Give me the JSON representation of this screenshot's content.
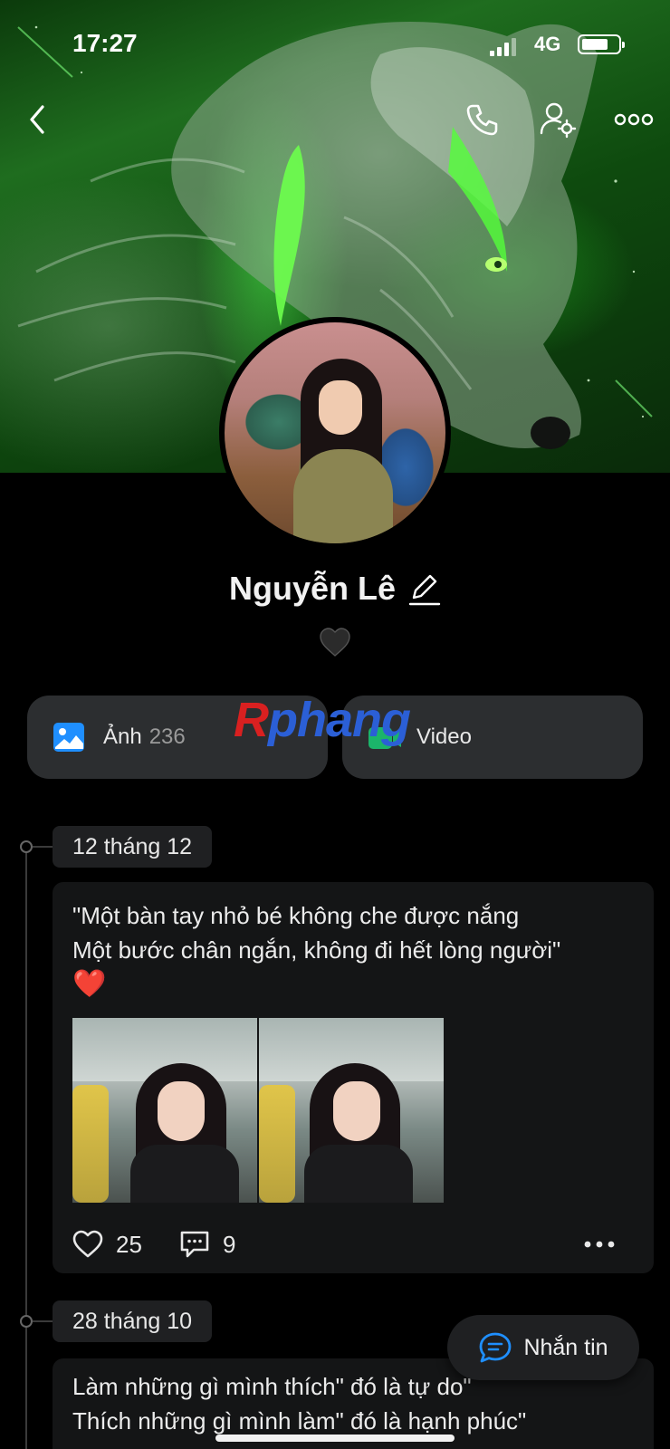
{
  "status_bar": {
    "time": "17:27",
    "network": "4G"
  },
  "header": {
    "back_icon": "chevron-left-icon",
    "call_icon": "phone-icon",
    "settings_icon": "user-settings-icon",
    "more_icon": "more-horizontal-icon"
  },
  "profile": {
    "name": "Nguyễn Lê",
    "edit_icon": "pencil-icon",
    "bio_icon": "black-heart-icon"
  },
  "media": {
    "photos_label": "Ảnh",
    "photos_count": "236",
    "videos_label": "Video"
  },
  "watermark": {
    "first_letter": "R",
    "rest": "phang"
  },
  "posts": [
    {
      "date": "12 tháng 12",
      "lines": [
        "\"Một bàn tay nhỏ bé không che được nắng",
        "Một bước chân ngắn, không đi hết lòng người\""
      ],
      "emoji": "❤️",
      "likes": "25",
      "comments": "9"
    },
    {
      "date": "28 tháng 10",
      "lines": [
        "Làm những gì mình thích\" đó là tự do\"",
        "Thích những gì mình làm\" đó là hạnh phúc\""
      ]
    }
  ],
  "message_button": {
    "label": "Nhắn tin"
  },
  "colors": {
    "accent_blue": "#1f8fff",
    "card_bg": "#141516",
    "chip_bg": "#1f2022",
    "media_btn_bg": "#2c2e30",
    "like_heart": "#e0202a"
  }
}
